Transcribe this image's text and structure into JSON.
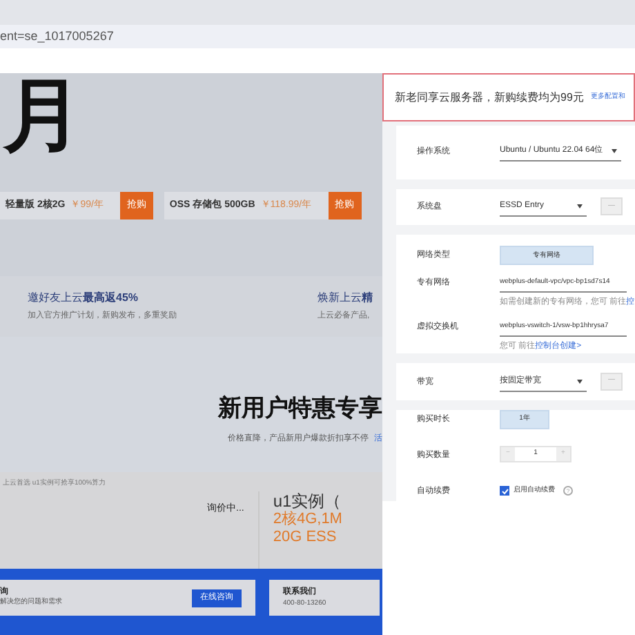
{
  "browser": {
    "url": "ent=se_1017005267"
  },
  "banner": {
    "headline": "月",
    "promos": [
      {
        "name": "轻量版 2核2G",
        "price": "￥99/年",
        "button": "抢购"
      },
      {
        "name": "OSS 存储包 500GB",
        "price": "￥118.99/年",
        "button": "抢购"
      }
    ]
  },
  "benefits": [
    {
      "title": "邀好友上云**最高返45%**",
      "desc": "加入官方推广计划，新购发布，多重奖励"
    },
    {
      "title": "焕新上云**精**",
      "desc": "上云必备产品,"
    }
  ],
  "section": {
    "title": "新用户特惠专享",
    "subtitle": "价格直降，产品新用户爆款折扣享不停",
    "link": "活",
    "note": "上云首选 u1实例可抢享100%算力"
  },
  "offer": {
    "status": "询价中...",
    "name": "u1实例（",
    "spec_1": "2核4G,1M",
    "spec_2": "20G ESS"
  },
  "footer": {
    "consult_title": "询",
    "consult_desc": "解决您的问题和需求",
    "consult_button": "在线咨询",
    "contact_title": "联系我们",
    "contact_phone": "400-80-13260"
  },
  "panel": {
    "notice": "新老同享云服务器，新购续费均为99元",
    "notice_link": "更多配置和",
    "groups": [
      {
        "rows": [
          {
            "kind": "select",
            "label": "操作系统",
            "value": "Ubuntu / Ubuntu 22.04 64位"
          }
        ]
      },
      {
        "rows": [
          {
            "kind": "select_stepper",
            "label": "系统盘",
            "value": "ESSD Entry",
            "stepper": "—"
          }
        ]
      },
      {
        "rows": [
          {
            "kind": "chips",
            "label": "网络类型",
            "options": [
              {
                "label": "专有网络",
                "selected": true
              }
            ]
          },
          {
            "kind": "text",
            "label": "专有网络",
            "value": "webplus-default-vpc/vpc-bp1sd7s14",
            "hint": "如需创建新的专有网络，您可 前往",
            "hint_link": "控"
          },
          {
            "kind": "text",
            "label": "虚拟交换机",
            "value": "webplus-vswitch-1/vsw-bp1hhrysa7",
            "hint": "您可 前往",
            "hint_link": "控制台创建>"
          }
        ]
      },
      {
        "rows": [
          {
            "kind": "select_stepper",
            "label": "带宽",
            "value": "按固定带宽",
            "stepper": "—"
          }
        ]
      },
      {
        "rows": [
          {
            "kind": "chips",
            "label": "购买时长",
            "options": [
              {
                "label": "1年",
                "selected": true
              }
            ]
          },
          {
            "kind": "number",
            "label": "购买数量",
            "minus": "−",
            "value": "1",
            "plus": "+"
          },
          {
            "kind": "checkbox",
            "label": "自动续费",
            "text": "启用自动续费",
            "checked": true,
            "help": "?"
          }
        ]
      }
    ]
  }
}
